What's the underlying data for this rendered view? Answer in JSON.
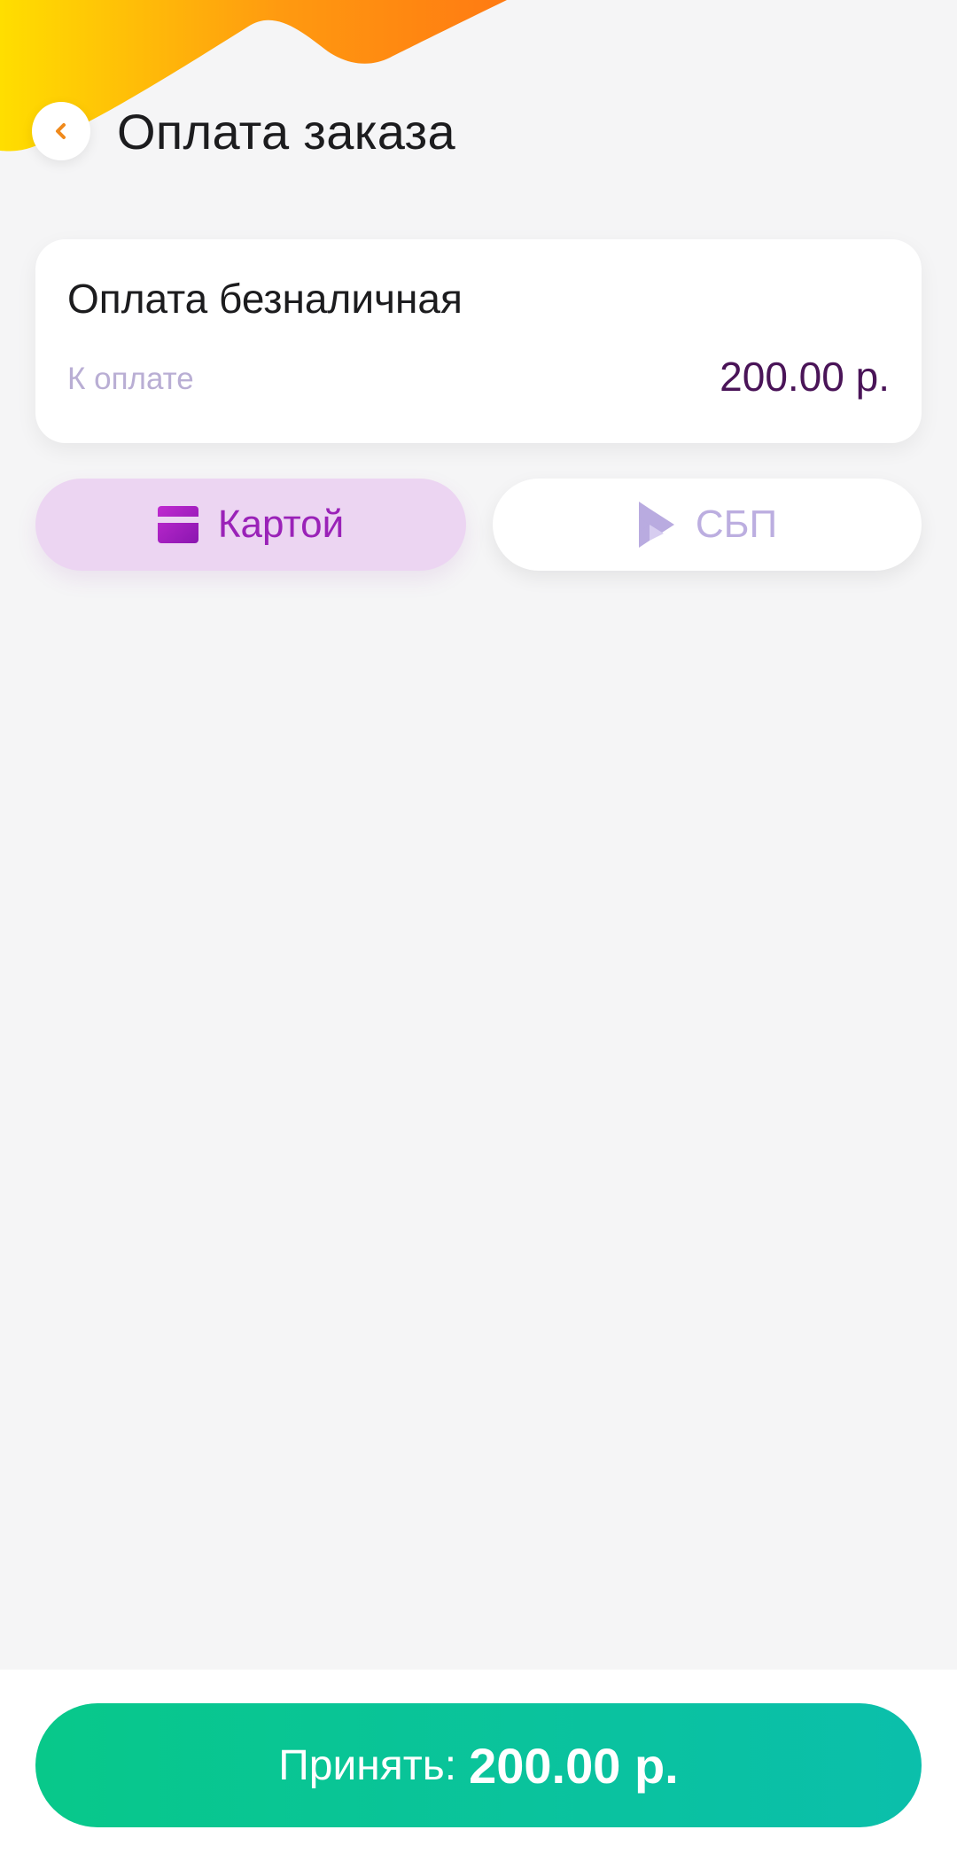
{
  "header": {
    "title": "Оплата заказа",
    "back_icon": "chevron-left-icon"
  },
  "payment": {
    "title": "Оплата безналичная",
    "amount_label": "К оплате",
    "amount": "200.00 р."
  },
  "methods": [
    {
      "label": "Картой",
      "icon": "credit-card-icon",
      "selected": true
    },
    {
      "label": "СБП",
      "icon": "sbp-icon",
      "selected": false
    }
  ],
  "footer": {
    "accept_prefix": "Принять:",
    "accept_amount": "200.00 р."
  },
  "colors": {
    "accent_purple": "#9a22b8",
    "accent_orange": "#ff8a00",
    "accept_green": "#08c88a",
    "amount_color": "#4a1458"
  }
}
